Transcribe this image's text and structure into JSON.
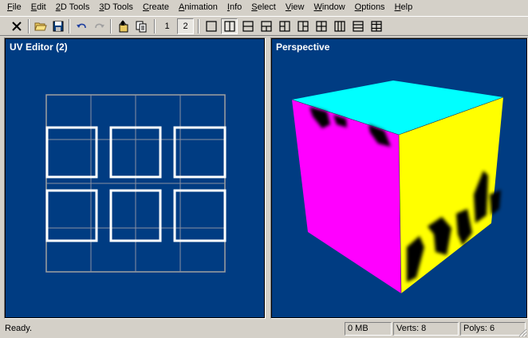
{
  "menu": [
    {
      "pre": "",
      "u": "F",
      "post": "ile"
    },
    {
      "pre": "",
      "u": "E",
      "post": "dit"
    },
    {
      "pre": "",
      "u": "2",
      "post": "D Tools"
    },
    {
      "pre": "",
      "u": "3",
      "post": "D Tools"
    },
    {
      "pre": "",
      "u": "C",
      "post": "reate"
    },
    {
      "pre": "",
      "u": "A",
      "post": "nimation"
    },
    {
      "pre": "",
      "u": "I",
      "post": "nfo"
    },
    {
      "pre": "",
      "u": "S",
      "post": "elect"
    },
    {
      "pre": "",
      "u": "V",
      "post": "iew"
    },
    {
      "pre": "",
      "u": "W",
      "post": "indow"
    },
    {
      "pre": "",
      "u": "O",
      "post": "ptions"
    },
    {
      "pre": "",
      "u": "H",
      "post": "elp"
    }
  ],
  "toolbar": {
    "num_1": "1",
    "num_2": "2",
    "icons": [
      "close-icon",
      "open-folder-icon",
      "save-icon",
      "undo-icon",
      "redo-icon",
      "import-icon",
      "copy-icon",
      "layout-single-icon",
      "layout-split-vertical-icon",
      "layout-split-horizontal-icon",
      "layout-three-a-icon",
      "layout-three-b-icon",
      "layout-four-icon",
      "layout-columns-icon",
      "layout-rows-icon",
      "layout-grid-icon"
    ]
  },
  "viewports": {
    "uv_title": "UV Editor (2)",
    "perspective_title": "Perspective"
  },
  "colors": {
    "viewport_bg": "#003c82",
    "cube_top": "#00ffff",
    "cube_left": "#ff00ff",
    "cube_right": "#ffff00"
  },
  "status": {
    "message": "Ready.",
    "memory": "0 MB",
    "verts": "Verts: 8",
    "polys": "Polys: 6"
  }
}
